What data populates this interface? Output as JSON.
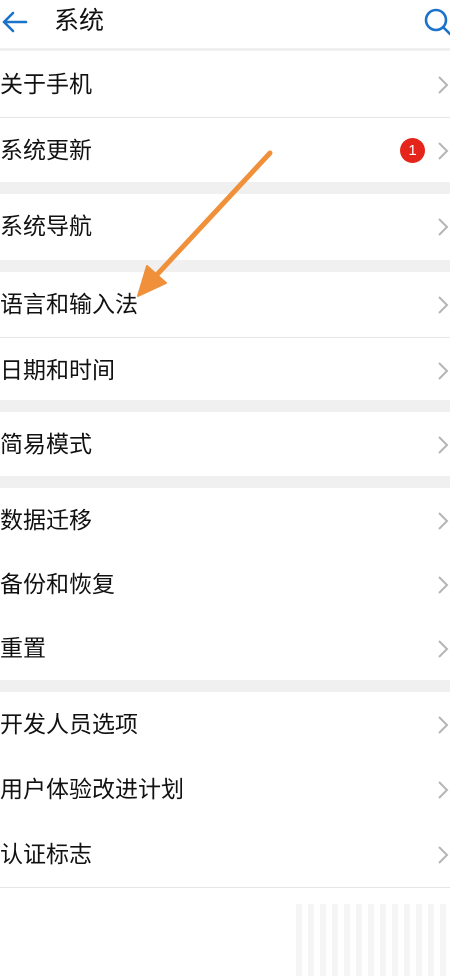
{
  "header": {
    "title": "系统"
  },
  "badge_count": "1",
  "items": [
    {
      "label": "关于手机"
    },
    {
      "label": "系统更新"
    },
    {
      "label": "系统导航"
    },
    {
      "label": "语言和输入法"
    },
    {
      "label": "日期和时间"
    },
    {
      "label": "简易模式"
    },
    {
      "label": "数据迁移"
    },
    {
      "label": "备份和恢复"
    },
    {
      "label": "重置"
    },
    {
      "label": "开发人员选项"
    },
    {
      "label": "用户体验改进计划"
    },
    {
      "label": "认证标志"
    }
  ],
  "colors": {
    "accent": "#1a73c8",
    "badge": "#e5251b",
    "annotation_arrow": "#f0903a"
  },
  "icons": {
    "back": "arrow-left-icon",
    "search": "search-icon",
    "chevron": "chevron-right-icon"
  }
}
